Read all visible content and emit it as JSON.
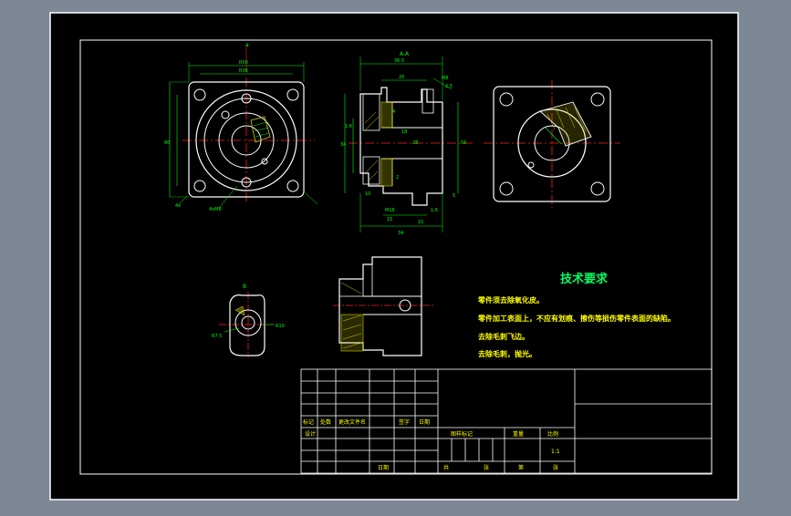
{
  "colors": {
    "background": "#7d8796",
    "sheet": "#000000",
    "border": "#ffffff",
    "outline": "#ffffff",
    "dimension": "#00ff00",
    "centerline": "#ff2020",
    "hatch": "#d0d000",
    "hidden": "#ffff00",
    "text_green": "#00ff66",
    "text_yellow": "#ffff00"
  },
  "views": {
    "front": {
      "label": "a",
      "dim_top": "R50",
      "dim_inner": "R36",
      "dim_left": "80",
      "dim_bottom_left": "4x",
      "dim_bottom_right": "4xM8"
    },
    "section": {
      "label": "A-A",
      "dims": [
        "36.5",
        "20",
        "M8",
        "2.5",
        "4",
        "18",
        "28",
        "56",
        "34",
        "10",
        "2",
        "5",
        "1.6",
        "10",
        "M16",
        "15",
        "1.6",
        "34"
      ]
    },
    "right": {
      "label": ""
    },
    "detail_b": {
      "label": "B",
      "dim_left": "R7.5",
      "dim_right": "R10"
    },
    "detail_c": {
      "label": ""
    }
  },
  "notes": {
    "title": "技术要求",
    "items": [
      "零件须去除氧化皮。",
      "零件加工表面上，不应有划痕、擦伤等损伤零件表面的缺陷。",
      "去除毛刺飞边。",
      "去除毛刺，抛光。"
    ]
  },
  "title_block": {
    "revision_headers": [
      "标记",
      "处数",
      "更改文件名",
      "签字",
      "日期"
    ],
    "design": "设计",
    "date": "日期",
    "stage_headers": [
      "图样标记",
      "重量",
      "比例"
    ],
    "scale": "1:1",
    "sheet_total": "共",
    "sheet_label": "张",
    "sheet_no": "第",
    "sheet_label2": "张"
  }
}
